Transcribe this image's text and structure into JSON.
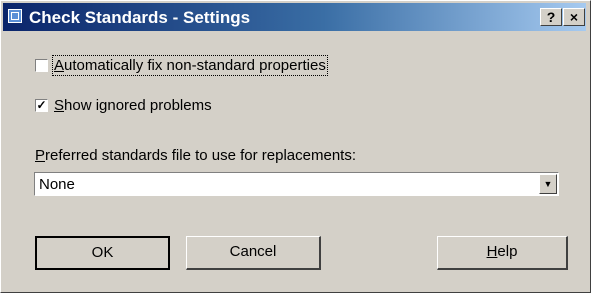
{
  "window": {
    "title": "Check Standards - Settings",
    "help_button": "?",
    "close_button": "×"
  },
  "options": {
    "auto_fix": {
      "label_ul": "A",
      "label_rest": "utomatically fix non-standard properties",
      "checked": false,
      "mark": ""
    },
    "show_ignored": {
      "label_ul": "S",
      "label_rest": "how ignored problems",
      "checked": true,
      "mark": "✓"
    }
  },
  "standards_file": {
    "label_ul": "P",
    "label_rest": "referred standards file to use for replacements:",
    "selected_value": "None",
    "dropdown_arrow": "▼"
  },
  "buttons": {
    "ok": "OK",
    "cancel": "Cancel",
    "help_ul": "H",
    "help_rest": "elp"
  }
}
